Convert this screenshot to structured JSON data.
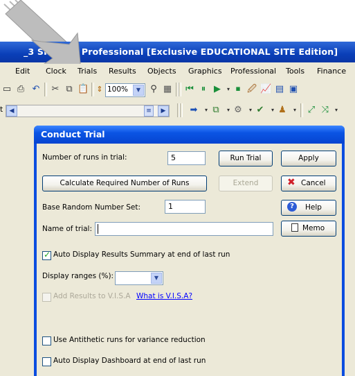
{
  "app": {
    "title": "_3  SIMU    08 Professional [Exclusive EDUCATIONAL SITE Edition]",
    "menus": [
      {
        "label": "Edit"
      },
      {
        "label": "Clock"
      },
      {
        "label": "Trials"
      },
      {
        "label": "Results"
      },
      {
        "label": "Objects"
      },
      {
        "label": "Graphics"
      },
      {
        "label": "Professional"
      },
      {
        "label": "Tools"
      },
      {
        "label": "Finance"
      }
    ],
    "zoom": "100%"
  },
  "dialog": {
    "title": "Conduct Trial",
    "runs_label": "Number of runs in trial:",
    "runs_value": "5",
    "run_trial": "Run Trial",
    "apply": "Apply",
    "calc_runs": "Calculate Required Number of Runs",
    "extend": "Extend",
    "cancel": "Cancel",
    "base_label": "Base Random Number Set:",
    "base_value": "1",
    "help": "Help",
    "name_label": "Name of trial:",
    "name_value": "",
    "memo": "Memo",
    "auto_display": "Auto Display Results Summary at end of last run",
    "display_ranges": "Display ranges (%):",
    "display_ranges_value": "",
    "add_visa": "Add Results to V.I.S.A",
    "what_visa": "What is V.I.S.A?",
    "antithetic": "Use Antithetic runs for variance reduction",
    "dashboard": "Auto Display Dashboard at end of last run"
  }
}
